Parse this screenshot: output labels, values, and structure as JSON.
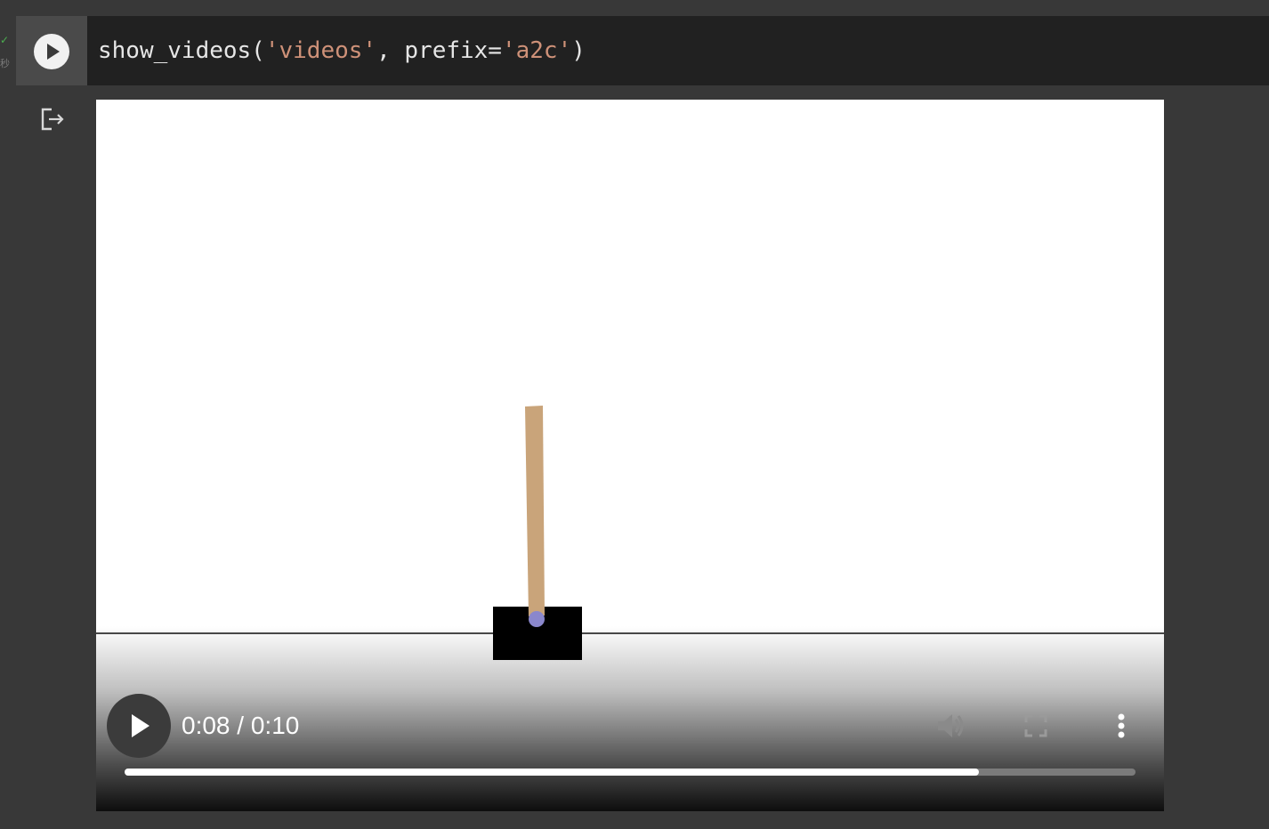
{
  "gutter": {
    "status_mark": "✓",
    "elapsed_label": "秒"
  },
  "code_cell": {
    "code_plain_1": "show_videos(",
    "code_str_1": "'videos'",
    "code_plain_2": ", prefix=",
    "code_str_2": "'a2c'",
    "code_plain_3": ")",
    "run_icon": "play-circle-icon"
  },
  "output": {
    "output_icon": "output-exit-icon"
  },
  "video_player": {
    "current_time": "0:08",
    "duration": "0:10",
    "progress": 0.845,
    "volume_icon": "volume-icon",
    "fullscreen_icon": "fullscreen-icon",
    "more_icon": "more-vertical-icon",
    "play_icon": "play-icon"
  },
  "colors": {
    "background": "#383838",
    "code_bg": "#212121",
    "string": "#ce9178",
    "pole": "#c9a47a",
    "axle": "#8a87cc",
    "cart": "#000000"
  }
}
